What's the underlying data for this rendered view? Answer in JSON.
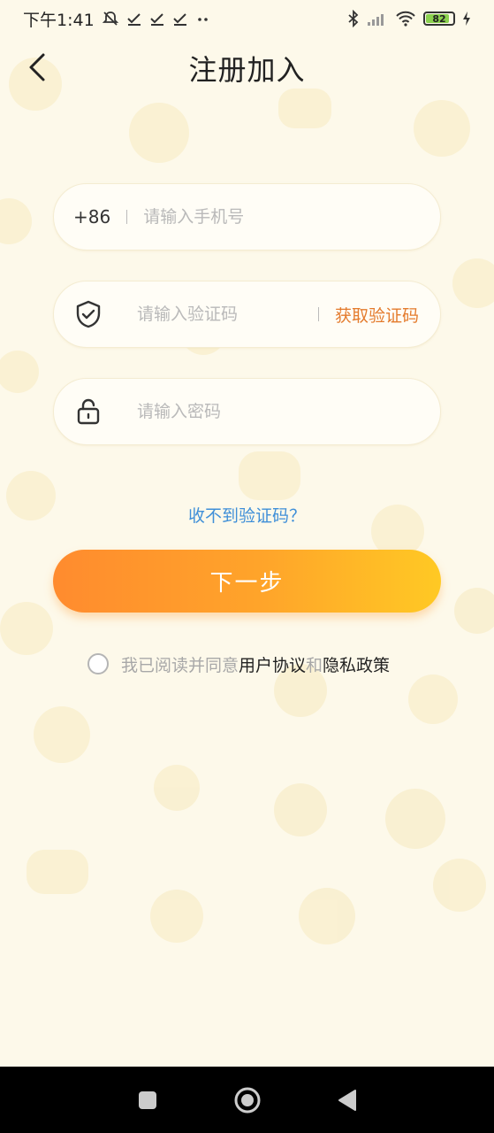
{
  "status_bar": {
    "time": "下午1:41",
    "battery": "82"
  },
  "header": {
    "title": "注册加入"
  },
  "form": {
    "phone_prefix": "+86",
    "phone_placeholder": "请输入手机号",
    "code_placeholder": "请输入验证码",
    "get_code_label": "获取验证码",
    "password_placeholder": "请输入密码"
  },
  "no_code_link": "收不到验证码？",
  "next_button": "下一步",
  "agreement": {
    "prefix": "我已阅读并同意",
    "user_agreement": "用户协议",
    "and": "和",
    "privacy_policy": "隐私政策"
  },
  "colors": {
    "background": "#fdf9ea",
    "accent_orange": "#e47b2d",
    "link_blue": "#3f8fd8",
    "button_gradient_start": "#ff8b2e",
    "button_gradient_end": "#ffc924"
  },
  "icons": [
    "bell-off-icon",
    "check-icon",
    "bluetooth-icon",
    "signal-icon",
    "wifi-icon",
    "battery-icon",
    "charging-icon",
    "back-icon",
    "shield-check-icon",
    "lock-icon",
    "square-icon",
    "home-circle-icon",
    "back-triangle-icon"
  ]
}
